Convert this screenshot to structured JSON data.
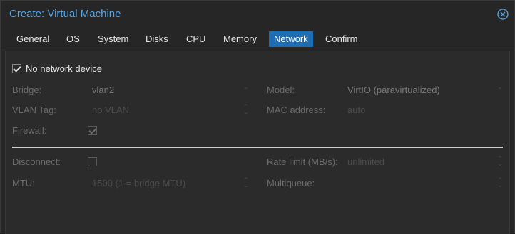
{
  "window": {
    "title": "Create: Virtual Machine"
  },
  "tabs": [
    {
      "label": "General"
    },
    {
      "label": "OS"
    },
    {
      "label": "System"
    },
    {
      "label": "Disks"
    },
    {
      "label": "CPU"
    },
    {
      "label": "Memory"
    },
    {
      "label": "Network"
    },
    {
      "label": "Confirm"
    }
  ],
  "active_tab": "Network",
  "form": {
    "no_network_device": {
      "label": "No network device",
      "checked": true
    },
    "bridge": {
      "label": "Bridge:",
      "value": "vlan2"
    },
    "vlan_tag": {
      "label": "VLAN Tag:",
      "placeholder": "no VLAN"
    },
    "firewall": {
      "label": "Firewall:",
      "checked": true
    },
    "model": {
      "label": "Model:",
      "value": "VirtIO (paravirtualized)"
    },
    "mac_address": {
      "label": "MAC address:",
      "placeholder": "auto"
    },
    "disconnect": {
      "label": "Disconnect:",
      "checked": false
    },
    "mtu": {
      "label": "MTU:",
      "placeholder": "1500 (1 = bridge MTU)"
    },
    "rate_limit": {
      "label": "Rate limit (MB/s):",
      "placeholder": "unlimited"
    },
    "multiqueue": {
      "label": "Multiqueue:",
      "value": ""
    }
  },
  "icons": {
    "close": "close-circle-icon",
    "checkbox": "checkmark-icon",
    "spinner": "spinner-arrows-icon",
    "dropdown": "chevron-down-icon"
  },
  "colors": {
    "accent": "#1f6eb3",
    "title": "#58a6e6",
    "background": "#262626"
  }
}
